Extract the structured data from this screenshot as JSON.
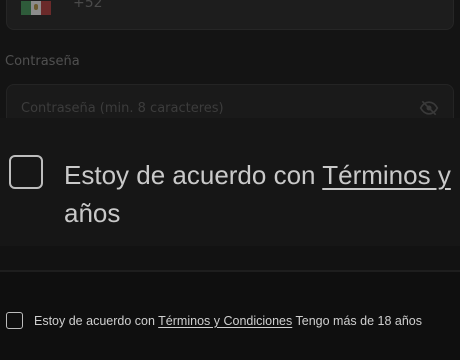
{
  "phone": {
    "dial_code": "+52",
    "flag_icon": "mexico-flag-icon"
  },
  "password": {
    "label": "Contraseña",
    "placeholder": "Contraseña (min. 8 caracteres)",
    "toggle_icon": "eye-off-icon"
  },
  "terms": {
    "prefix": "Estoy de acuerdo con ",
    "link": "Términos y Condiciones",
    "suffix": " Tengo más de 18 años"
  },
  "zoom": {
    "prefix": "Estoy de acuerdo con ",
    "link": "Términos y",
    "second_line": "años"
  },
  "colors": {
    "background": "#0f0f0f",
    "text": "#cfcfcf",
    "checkbox_border": "#bdbdbd"
  }
}
